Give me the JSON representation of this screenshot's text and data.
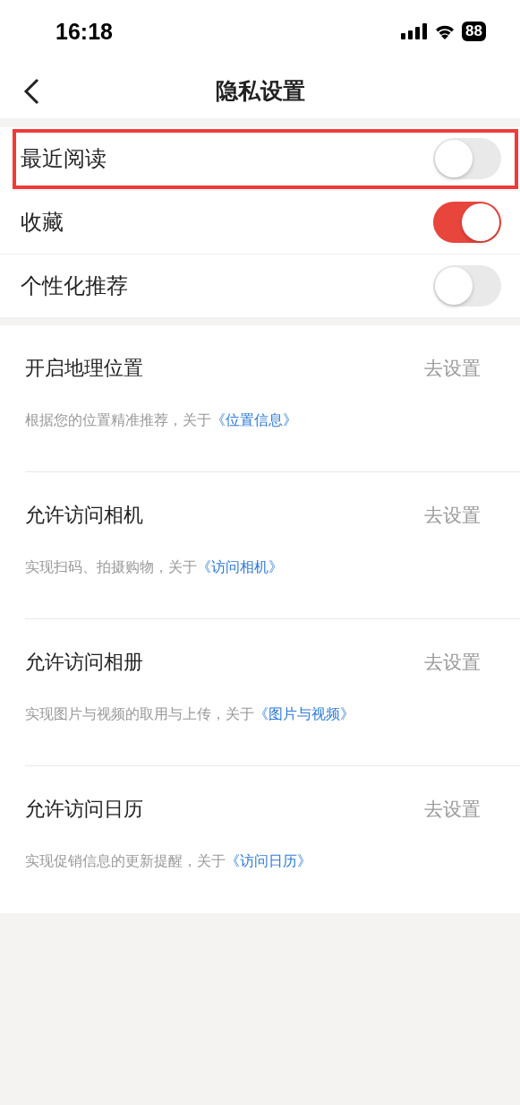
{
  "status_bar": {
    "time": "16:18",
    "battery": "88"
  },
  "nav": {
    "title": "隐私设置"
  },
  "switches": [
    {
      "label": "最近阅读",
      "on": false,
      "highlighted": true
    },
    {
      "label": "收藏",
      "on": true,
      "highlighted": false
    },
    {
      "label": "个性化推荐",
      "on": false,
      "highlighted": false
    }
  ],
  "permissions": [
    {
      "title": "开启地理位置",
      "action": "去设置",
      "note": "根据您的位置精准推荐，关于",
      "link": "《位置信息》"
    },
    {
      "title": "允许访问相机",
      "action": "去设置",
      "note": "实现扫码、拍摄购物，关于",
      "link": "《访问相机》"
    },
    {
      "title": "允许访问相册",
      "action": "去设置",
      "note": "实现图片与视频的取用与上传，关于",
      "link": "《图片与视频》"
    },
    {
      "title": "允许访问日历",
      "action": "去设置",
      "note": "实现促销信息的更新提醒，关于",
      "link": "《访问日历》"
    }
  ]
}
